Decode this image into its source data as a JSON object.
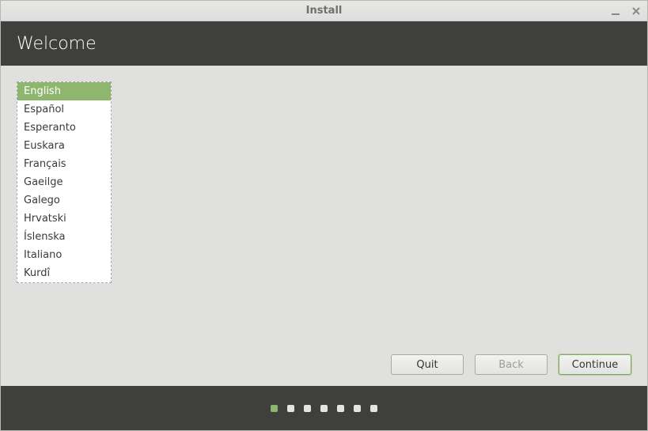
{
  "titlebar": {
    "title": "Install"
  },
  "header": {
    "title": "Welcome"
  },
  "languages": {
    "selected_index": 0,
    "items": [
      "English",
      "Español",
      "Esperanto",
      "Euskara",
      "Français",
      "Gaeilge",
      "Galego",
      "Hrvatski",
      "Íslenska",
      "Italiano",
      "Kurdî"
    ]
  },
  "buttons": {
    "quit": "Quit",
    "back": "Back",
    "continue": "Continue"
  },
  "progress": {
    "total_steps": 7,
    "active_index": 0
  }
}
